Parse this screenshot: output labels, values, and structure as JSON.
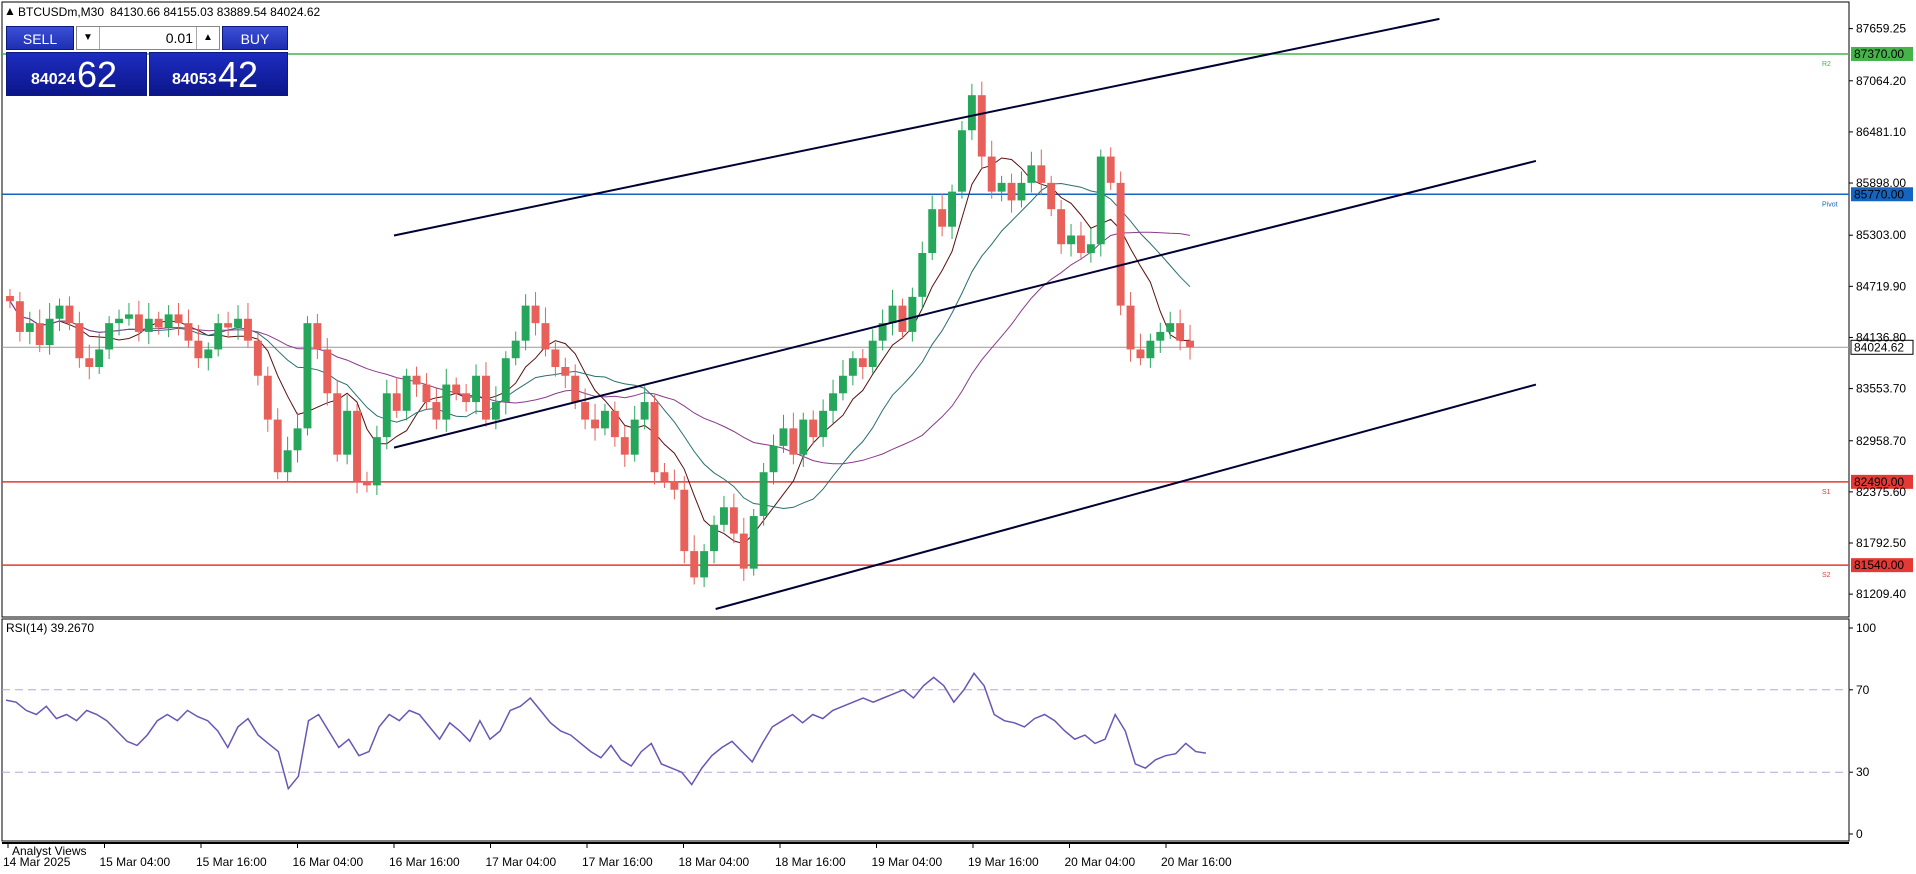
{
  "header": {
    "symbol": "BTCUSDm,M30",
    "ohlc": "84130.66 84155.03 83889.54 84024.62"
  },
  "trade_panel": {
    "sell_label": "SELL",
    "buy_label": "BUY",
    "lot": "0.01",
    "bid_small": "84024",
    "bid_big": "62",
    "ask_small": "84053",
    "ask_big": "42"
  },
  "colors": {
    "bull": "#26a65b",
    "bear": "#e8605a",
    "r2": "#45b24a",
    "pivot": "#1565c0",
    "support": "#e53935",
    "channel": "#000033",
    "rsi": "#6a55b5",
    "ma_fast": "#5a1010",
    "ma_mid": "#2a6e6e",
    "ma_slow": "#8a3a8a"
  },
  "chart_data": [
    {
      "type": "candlestick",
      "symbol": "BTCUSDm",
      "timeframe": "M30",
      "current_price": "84024.62",
      "y_ticks": [
        "87659.25",
        "87064.20",
        "86481.10",
        "85898.00",
        "85303.00",
        "84719.90",
        "84136.80",
        "83553.70",
        "82958.70",
        "82375.60",
        "81792.50",
        "81209.40"
      ],
      "ylim": [
        80960,
        87940
      ],
      "x_ticks": [
        "14 Mar 2025",
        "15 Mar 04:00",
        "15 Mar 16:00",
        "16 Mar 04:00",
        "16 Mar 16:00",
        "17 Mar 04:00",
        "17 Mar 16:00",
        "18 Mar 04:00",
        "18 Mar 16:00",
        "19 Mar 04:00",
        "19 Mar 16:00",
        "20 Mar 04:00",
        "20 Mar 16:00"
      ],
      "levels": [
        {
          "name": "R2",
          "price": 87370.0,
          "label": "87370.00",
          "tag": "R2"
        },
        {
          "name": "Pivot",
          "price": 85770.0,
          "label": "85770.00",
          "tag": "Pivot"
        },
        {
          "name": "S1",
          "price": 82490.0,
          "label": "82490.00",
          "tag": "S1"
        },
        {
          "name": "S2",
          "price": 81540.0,
          "label": "81540.00",
          "tag": "S2"
        }
      ],
      "channel_lines": [
        {
          "from": [
            "16 Mar 00:00",
            85300
          ],
          "to": [
            "21 Mar 10:00",
            87770
          ]
        },
        {
          "from": [
            "16 Mar 00:00",
            82880
          ],
          "to": [
            "21 Mar 22:00",
            86150
          ]
        },
        {
          "from": [
            "17 Mar 16:00",
            81040
          ],
          "to": [
            "21 Mar 22:00",
            83600
          ]
        }
      ],
      "close_path": [
        84550,
        84200,
        84300,
        84050,
        84350,
        84500,
        84300,
        83900,
        83800,
        84000,
        84300,
        84350,
        84400,
        84200,
        84350,
        84250,
        84400,
        84300,
        84100,
        83900,
        84000,
        84300,
        84250,
        84350,
        84100,
        83700,
        83200,
        82600,
        82850,
        83100,
        84300,
        84000,
        83500,
        82800,
        83300,
        82500,
        82450,
        83000,
        83500,
        83300,
        83700,
        83600,
        83400,
        83200,
        83600,
        83500,
        83400,
        83700,
        83200,
        83400,
        83900,
        84100,
        84500,
        84300,
        84000,
        83800,
        83700,
        83400,
        83200,
        83100,
        83300,
        83000,
        82800,
        83200,
        83400,
        82600,
        82500,
        82400,
        81700,
        81400,
        81700,
        82000,
        82200,
        81900,
        81500,
        82100,
        82600,
        82900,
        83100,
        82800,
        83200,
        83000,
        83300,
        83500,
        83700,
        83900,
        83800,
        84100,
        84300,
        84500,
        84200,
        84600,
        85100,
        85600,
        85400,
        85800,
        86500,
        86900,
        86200,
        85800,
        85900,
        85700,
        85900,
        86100,
        85900,
        85600,
        85200,
        85300,
        85100,
        85200,
        86200,
        85900,
        84500,
        84000,
        83900,
        84100,
        84200,
        84300,
        84100,
        84024.62
      ]
    },
    {
      "type": "line",
      "title": "RSI(14) 39.2670",
      "y_ticks": [
        "100",
        "70",
        "30",
        "0"
      ],
      "ylim": [
        0,
        100
      ],
      "levels": [
        70,
        30
      ],
      "values": [
        65,
        64,
        60,
        58,
        62,
        56,
        58,
        55,
        60,
        58,
        55,
        50,
        45,
        43,
        48,
        55,
        58,
        55,
        60,
        57,
        55,
        50,
        42,
        52,
        56,
        48,
        44,
        40,
        22,
        28,
        55,
        58,
        50,
        42,
        46,
        38,
        40,
        52,
        58,
        55,
        60,
        58,
        52,
        46,
        54,
        50,
        45,
        55,
        46,
        50,
        60,
        62,
        66,
        60,
        54,
        50,
        48,
        44,
        40,
        37,
        43,
        36,
        33,
        40,
        44,
        34,
        32,
        30,
        24,
        32,
        38,
        42,
        45,
        40,
        35,
        44,
        52,
        55,
        58,
        54,
        58,
        56,
        60,
        62,
        64,
        66,
        64,
        66,
        68,
        70,
        66,
        72,
        76,
        72,
        64,
        70,
        78,
        72,
        58,
        55,
        54,
        52,
        56,
        58,
        55,
        50,
        46,
        48,
        44,
        46,
        58,
        50,
        34,
        32,
        36,
        38,
        39,
        44,
        40,
        39.27
      ]
    }
  ]
}
